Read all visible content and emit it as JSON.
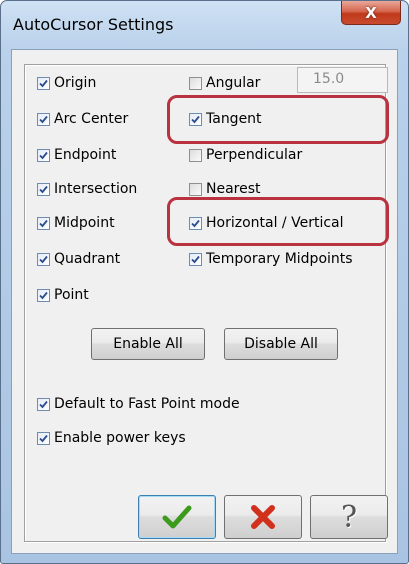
{
  "window": {
    "title": "AutoCursor Settings",
    "close_glyph": "X"
  },
  "colors": {
    "highlight": "#b8323f",
    "check": "#2a4c8f",
    "ok": "#3c9a1c",
    "cancel": "#d1301c"
  },
  "left_column": [
    {
      "label": "Origin",
      "checked": true
    },
    {
      "label": "Arc Center",
      "checked": true
    },
    {
      "label": "Endpoint",
      "checked": true
    },
    {
      "label": "Intersection",
      "checked": true
    },
    {
      "label": "Midpoint",
      "checked": true
    },
    {
      "label": "Quadrant",
      "checked": true
    },
    {
      "label": "Point",
      "checked": true
    }
  ],
  "right_column": [
    {
      "label": "Angular",
      "checked": false
    },
    {
      "label": "Tangent",
      "checked": true
    },
    {
      "label": "Perpendicular",
      "checked": false
    },
    {
      "label": "Nearest",
      "checked": false
    },
    {
      "label": "Horizontal / Vertical",
      "checked": true
    },
    {
      "label": "Temporary Midpoints",
      "checked": true
    }
  ],
  "angle_value": "15.0",
  "buttons": {
    "enable_all": "Enable All",
    "disable_all": "Disable All"
  },
  "options": [
    {
      "label": "Default to Fast Point mode",
      "checked": true
    },
    {
      "label": "Enable power keys",
      "checked": true
    }
  ],
  "footer": {
    "ok_icon": "checkmark-icon",
    "cancel_icon": "x-icon",
    "help_icon": "question-icon",
    "help_glyph": "?"
  }
}
